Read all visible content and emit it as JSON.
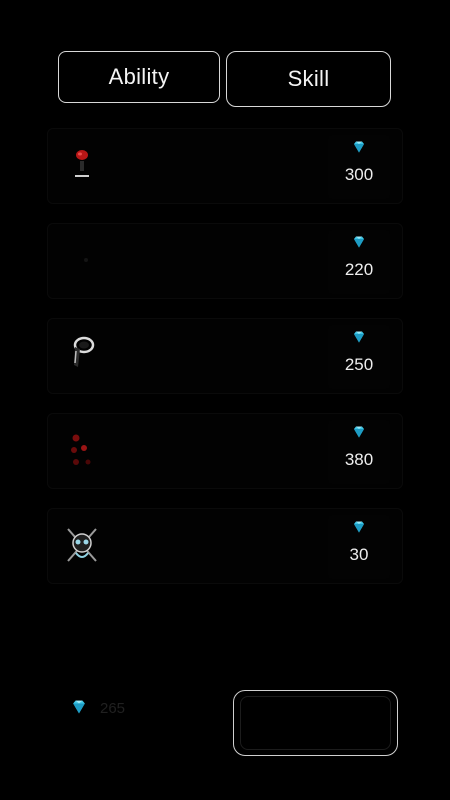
{
  "tabs": {
    "ability_label": "Ability",
    "skill_label": "Skill"
  },
  "shop": {
    "items": [
      {
        "price": "300",
        "icon": "red-potion-icon"
      },
      {
        "price": "220",
        "icon": "dark-item-icon"
      },
      {
        "price": "250",
        "icon": "ring-icon"
      },
      {
        "price": "380",
        "icon": "red-berries-icon"
      },
      {
        "price": "30",
        "icon": "skull-crossbones-icon"
      }
    ]
  },
  "footer": {
    "balance": "265",
    "currency_icon": "diamond-icon"
  },
  "colors": {
    "gem": "#3fc7e6",
    "accent_red": "#c01818",
    "background": "#000000"
  }
}
